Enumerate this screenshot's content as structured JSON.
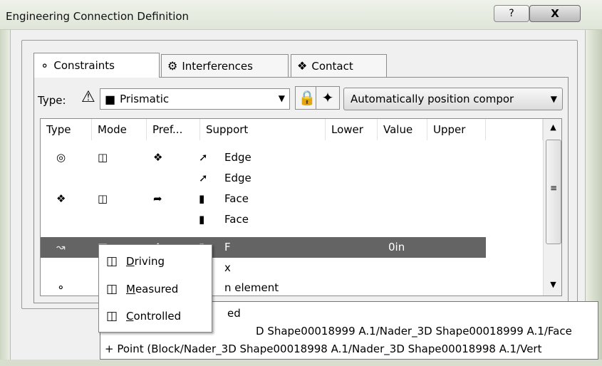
{
  "window": {
    "title": "Engineering Connection Definition",
    "help_label": "?",
    "close_label": "X"
  },
  "tabs": [
    {
      "label": "Constraints",
      "icon": "constraints-icon",
      "active": true
    },
    {
      "label": "Interferences",
      "icon": "interferences-icon",
      "active": false
    },
    {
      "label": "Contact",
      "icon": "contact-icon",
      "active": false
    }
  ],
  "type_row": {
    "label": "Type:",
    "type_value": "Prismatic",
    "position_value": "Automatically position compor"
  },
  "list": {
    "columns": [
      "Type",
      "Mode",
      "Pref...",
      "Support",
      "Lower",
      "Value",
      "Upper"
    ],
    "rows": [
      {
        "support": "Edge"
      },
      {
        "support": "Edge"
      },
      {
        "support": "Face"
      },
      {
        "support": "Face"
      },
      {
        "support": "F",
        "value": "0in",
        "selected": true
      },
      {
        "support": "x"
      },
      {
        "support": "n element"
      }
    ]
  },
  "context_menu": {
    "items": [
      {
        "pre": "",
        "mnemonic": "D",
        "post": "riving"
      },
      {
        "pre": "",
        "mnemonic": "M",
        "post": "easured"
      },
      {
        "pre": "",
        "mnemonic": "C",
        "post": "ontrolled"
      }
    ]
  },
  "tooltip": {
    "lines": [
      "ed",
      "D Shape00018999 A.1/Nader_3D Shape00018999 A.1/Face",
      "+ Point (Block/Nader_3D Shape00018998 A.1/Nader_3D Shape00018998 A.1/Vert"
    ]
  },
  "colors": {
    "selection": "#646464",
    "background": "#f0f0f0"
  }
}
